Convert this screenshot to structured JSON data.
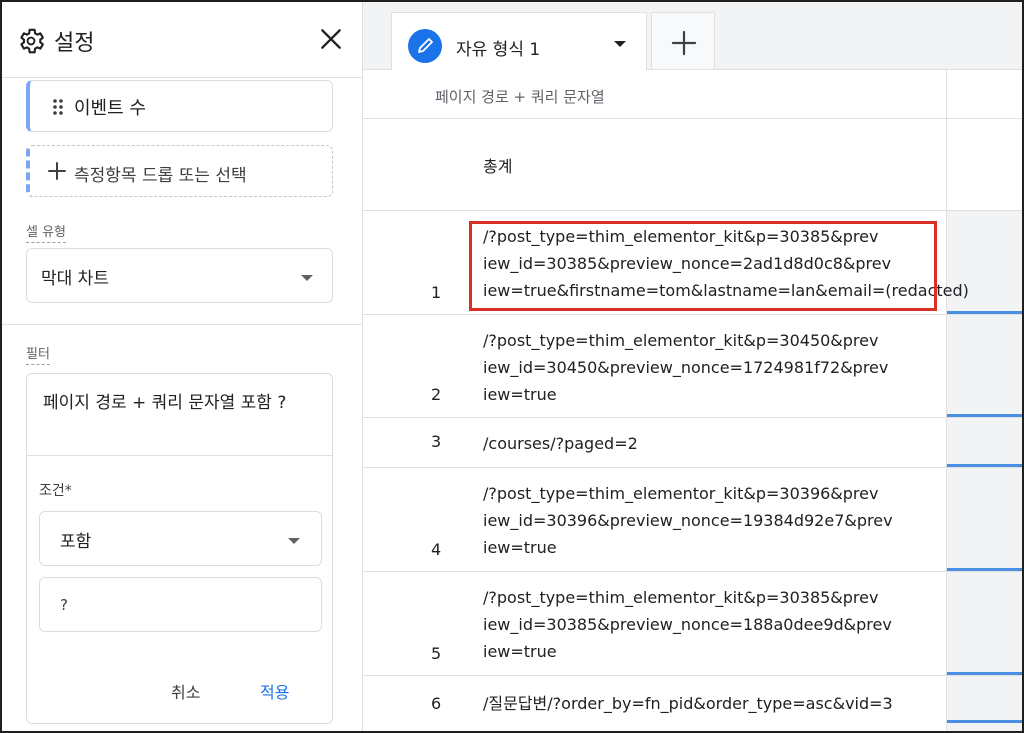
{
  "settings": {
    "title": "설정",
    "metric_label": "이벤트 수",
    "add_metric_label": "측정항목 드롭 또는 선택",
    "cell_type_label": "셀 유형",
    "cell_type_value": "막대 차트",
    "filter_label": "필터",
    "filter_title": "페이지 경로 + 쿼리 문자열 포함 ?",
    "condition_label": "조건*",
    "condition_value": "포함",
    "condition_input_value": "?",
    "cancel_label": "취소",
    "apply_label": "적용"
  },
  "tabs": {
    "active_label": "자유 형식 1"
  },
  "table": {
    "column_header": "페이지 경로 + 쿼리 문자열",
    "total_label": "총계",
    "rows": [
      {
        "num": "1",
        "text": "/?post_type=thim_elementor_kit&p=30385&prev\niew_id=30385&preview_nonce=2ad1d8d0c8&prev\niew=true&firstname=tom&lastname=lan&email=(redacted)"
      },
      {
        "num": "2",
        "text": "/?post_type=thim_elementor_kit&p=30450&prev\niew_id=30450&preview_nonce=1724981f72&prev\niew=true"
      },
      {
        "num": "3",
        "text": "/courses/?paged=2"
      },
      {
        "num": "4",
        "text": "/?post_type=thim_elementor_kit&p=30396&prev\niew_id=30396&preview_nonce=19384d92e7&prev\niew=true"
      },
      {
        "num": "5",
        "text": "/?post_type=thim_elementor_kit&p=30385&prev\niew_id=30385&preview_nonce=188a0dee9d&prev\niew=true"
      },
      {
        "num": "6",
        "text": "/질문답변/?order_by=fn_pid&order_type=asc&vid=3"
      }
    ]
  },
  "colors": {
    "accent": "#1a73e8",
    "highlight_border": "#d93025"
  }
}
